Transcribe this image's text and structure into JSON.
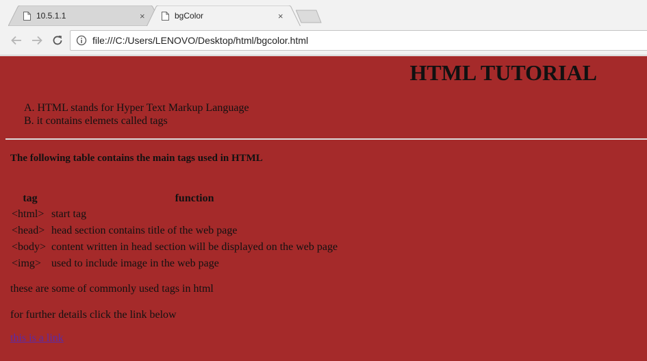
{
  "browser": {
    "tabs": [
      {
        "title": "10.5.1.1",
        "active": false
      },
      {
        "title": "bgColor",
        "active": true
      }
    ],
    "close_glyph": "×",
    "url": "file:///C:/Users/LENOVO/Desktop/html/bgcolor.html",
    "icons": {
      "back": "back-arrow-icon",
      "forward": "forward-arrow-icon",
      "reload": "reload-icon",
      "info": "info-icon",
      "page": "page-icon"
    }
  },
  "page": {
    "background_color": "#a52a2a",
    "heading": "HTML TUTORIAL",
    "list": [
      "A. HTML stands for Hyper Text Markup Language",
      "B. it contains elemets called tags"
    ],
    "intro": "The following table contains the main tags used in HTML",
    "table": {
      "headers": [
        "tag",
        "function"
      ],
      "rows": [
        [
          "<html>",
          "start tag"
        ],
        [
          "<head>",
          "head section contains title of the web page"
        ],
        [
          "<body>",
          "content written in head section will be displayed on the web page"
        ],
        [
          "<img>",
          "used to include image in the web page"
        ]
      ]
    },
    "para1": "these are some of commonly used tags in html",
    "para2": "for further details click the link below",
    "link_text": "this is a link"
  }
}
